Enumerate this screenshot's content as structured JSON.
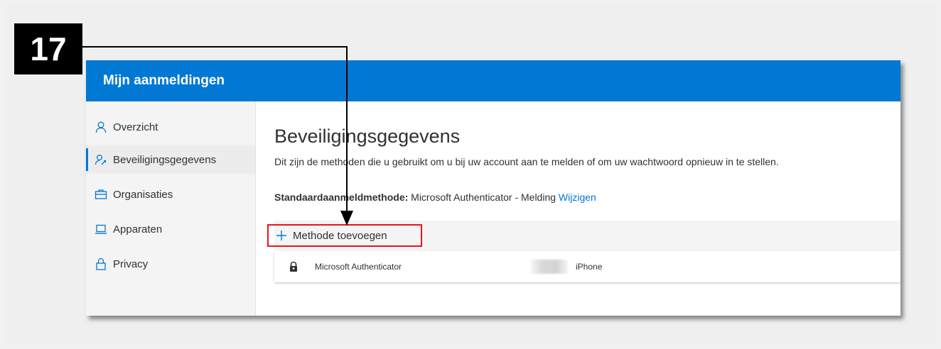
{
  "step_label": "17",
  "app": {
    "title": "Mijn aanmeldingen"
  },
  "sidebar": {
    "items": [
      {
        "label": "Overzicht",
        "icon": "person-icon"
      },
      {
        "label": "Beveiligingsgegevens",
        "icon": "security-info-icon",
        "active": true
      },
      {
        "label": "Organisaties",
        "icon": "organizations-icon"
      },
      {
        "label": "Apparaten",
        "icon": "laptop-icon"
      },
      {
        "label": "Privacy",
        "icon": "lock-icon"
      }
    ]
  },
  "main": {
    "title": "Beveiligingsgegevens",
    "description": "Dit zijn de methoden die u gebruikt om u bij uw account aan te melden of om uw wachtwoord opnieuw in te stellen.",
    "default_label": "Standaardaanmeldmethode:",
    "default_value": " Microsoft Authenticator - Melding ",
    "change_link": "Wijzigen",
    "add_method_label": "Methode toevoegen",
    "methods": [
      {
        "name": "Microsoft Authenticator",
        "device": "iPhone",
        "icon": "authenticator-lock-icon"
      }
    ]
  },
  "colors": {
    "brand": "#0078d4",
    "highlight": "#e8141b"
  }
}
